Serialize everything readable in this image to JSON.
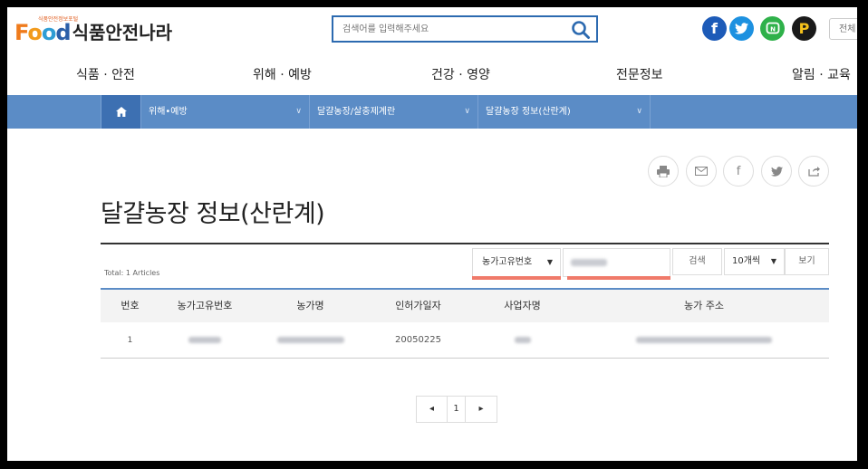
{
  "header": {
    "logo_text_food": "Food",
    "logo_subtitle": "식품안전정보포털",
    "logo_name": "식품안전나라",
    "search_placeholder": "검색어를 입력해주세요",
    "all_label": "전체",
    "social": [
      "facebook-icon",
      "twitter-icon",
      "naver-icon",
      "p-icon"
    ]
  },
  "nav": {
    "items": [
      "식품 · 안전",
      "위해 · 예방",
      "건강 · 영양",
      "전문정보",
      "알림 · 교육"
    ]
  },
  "breadcrumb": {
    "home_icon": "home-icon",
    "items": [
      "위해•예방",
      "달걀농장/살충제계란",
      "달걀농장 정보(산란계)"
    ]
  },
  "share_icons": [
    "print-icon",
    "mail-icon",
    "facebook-icon",
    "twitter-icon",
    "share-icon"
  ],
  "page": {
    "title": "달걀농장 정보(산란계)",
    "total_text": "Total: 1 Articles"
  },
  "filters": {
    "search_field": "농가고유번호",
    "search_button": "검색",
    "page_size": "10개씩",
    "view_button": "보기"
  },
  "table": {
    "headers": [
      "번호",
      "농가고유번호",
      "농가명",
      "인허가일자",
      "사업자명",
      "농가 주소"
    ],
    "rows": [
      {
        "no": "1",
        "license_date": "20050225"
      }
    ]
  },
  "pagination": {
    "prev": "◂",
    "current": "1",
    "next": "▸"
  },
  "colors": {
    "breadcrumb_bar": "#5b8cc6",
    "home_segment": "#3d70b2",
    "search_border": "#2c6ab0",
    "highlight": "#f07a6a"
  }
}
